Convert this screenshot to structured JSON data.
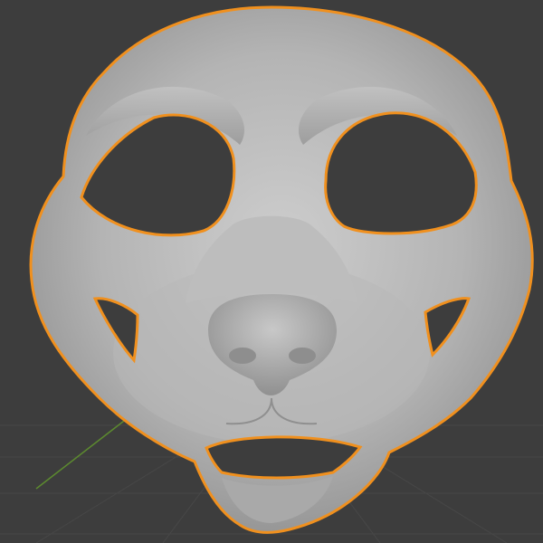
{
  "viewport": {
    "background": "#3d3d3d",
    "grid_color": "#474747",
    "axis_y_color": "#5c8a2f",
    "selection_outline_color": "#f0901e",
    "mesh_base_color": "#b3b3b3",
    "mesh_highlight_color": "#cfcfcf",
    "mesh_shadow_color": "#8a8a8a"
  },
  "object": {
    "icon": "mask-mesh-icon",
    "selected": true
  }
}
